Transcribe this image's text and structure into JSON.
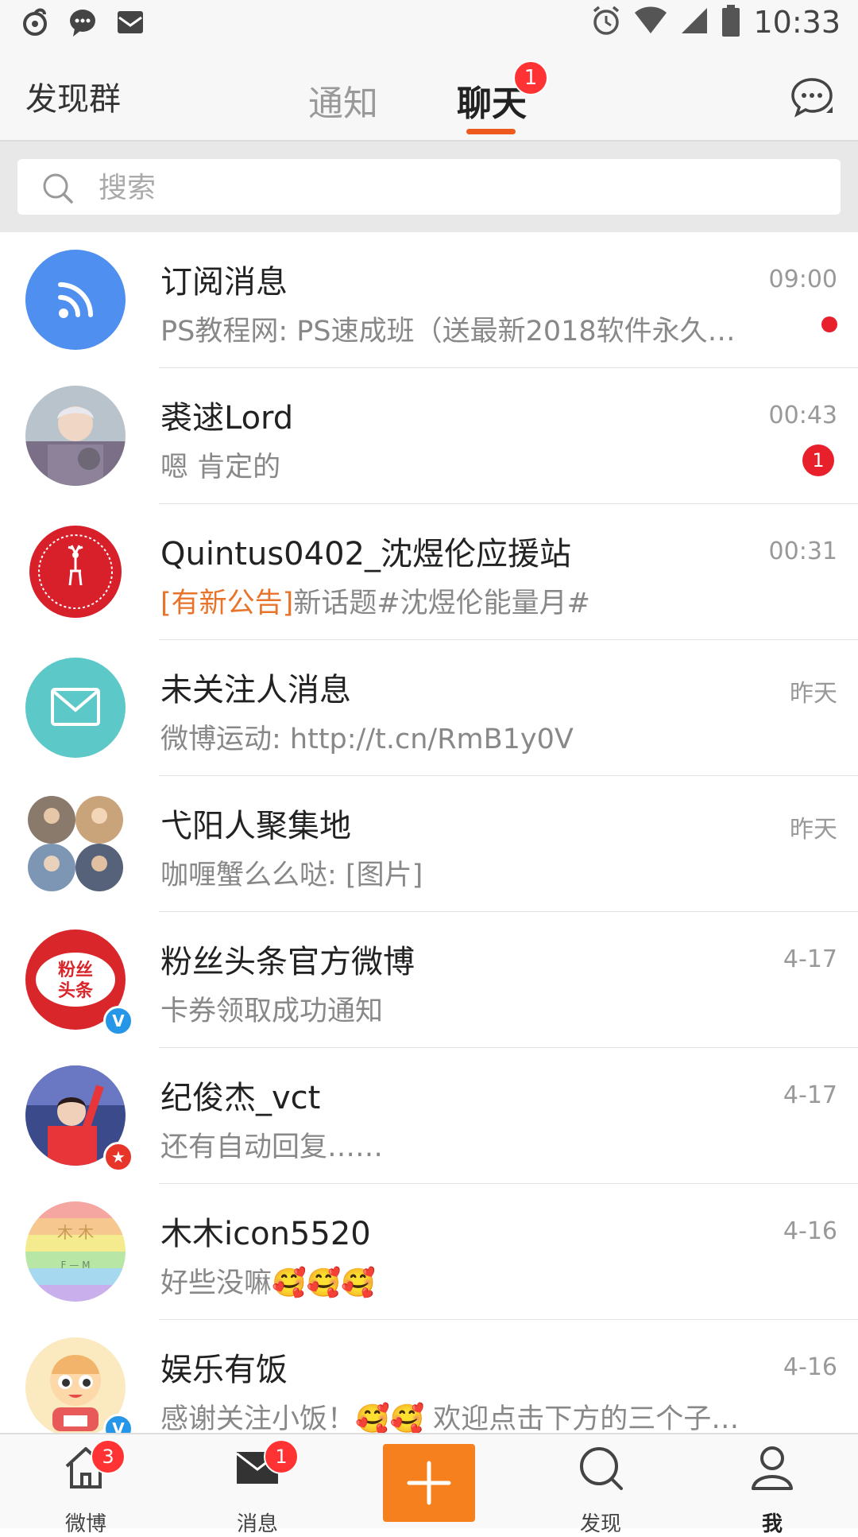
{
  "status_bar": {
    "time": "10:33",
    "icons": [
      "weibo-icon",
      "chat-bubble-icon",
      "mail-icon",
      "alarm-icon",
      "wifi-icon",
      "signal-icon",
      "battery-icon"
    ]
  },
  "header": {
    "discover_label": "发现群",
    "tabs": [
      {
        "label": "通知",
        "active": false
      },
      {
        "label": "聊天",
        "active": true,
        "badge": "1"
      }
    ],
    "compose_icon": "new-chat-icon"
  },
  "search": {
    "placeholder": "搜索"
  },
  "conversations": [
    {
      "name": "订阅消息",
      "preview": "PS教程网: PS速成班（送最新2018软件永久…",
      "time": "09:00",
      "indicator": "dot",
      "avatar": "rss-icon",
      "avatar_color": "#4f8ff0"
    },
    {
      "name": "裘逑Lord",
      "preview": "嗯 肯定的",
      "time": "00:43",
      "badge": "1",
      "avatar": "user-photo"
    },
    {
      "name": "Quintus0402_沈煜伦应援站",
      "tag": "[有新公告]",
      "preview": "新话题#沈煜伦能量月#",
      "time": "00:31",
      "avatar": "deer-logo"
    },
    {
      "name": "未关注人消息",
      "preview": "微博运动: http://t.cn/RmB1y0V",
      "time": "昨天",
      "avatar": "envelope-icon",
      "avatar_color": "#5cc8c8"
    },
    {
      "name": "弋阳人聚集地",
      "preview": "咖喱蟹么么哒: [图片]",
      "time": "昨天",
      "avatar": "group-photos"
    },
    {
      "name": "粉丝头条官方微博",
      "preview": "卡券领取成功通知",
      "time": "4-17",
      "avatar": "fans-headline-logo",
      "avatar_text": "粉丝\n头条",
      "verified": true
    },
    {
      "name": "纪俊杰_vct",
      "preview": "还有自动回复……",
      "time": "4-17",
      "avatar": "user-photo",
      "star": true
    },
    {
      "name": "木木icon5520",
      "preview": "好些没嘛🥰🥰🥰",
      "time": "4-16",
      "avatar": "rainbow-avatar"
    },
    {
      "name": "娱乐有饭",
      "preview": "感谢关注小饭！🥰🥰 欢迎点击下方的三个子…",
      "time": "4-16",
      "avatar": "cartoon-avatar",
      "verified": true
    }
  ],
  "bottom_nav": [
    {
      "label": "微博",
      "icon": "home-icon",
      "badge": "3"
    },
    {
      "label": "消息",
      "icon": "message-icon",
      "badge": "1"
    },
    {
      "label": "",
      "icon": "plus-icon"
    },
    {
      "label": "发现",
      "icon": "discover-icon"
    },
    {
      "label": "我",
      "icon": "profile-icon"
    }
  ],
  "colors": {
    "accent": "#ee5a1e",
    "badge": "#f33333",
    "plus": "#f6801e"
  }
}
